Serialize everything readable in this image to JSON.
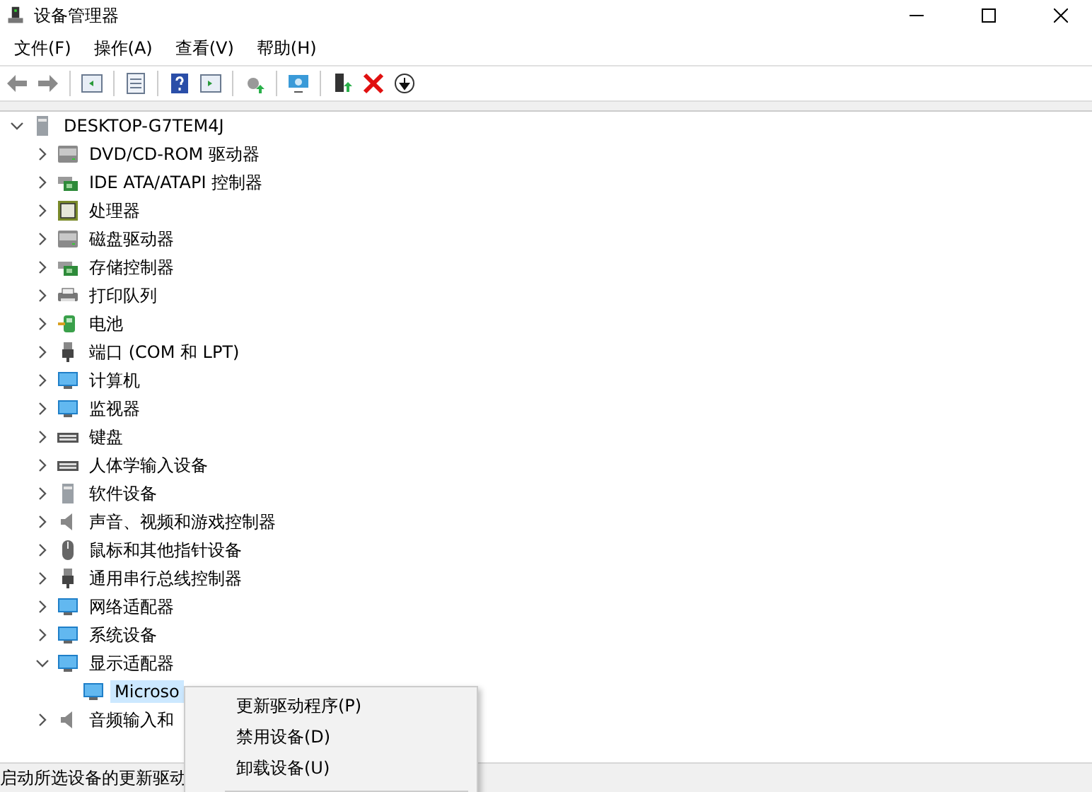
{
  "window": {
    "title": "设备管理器"
  },
  "menu_bar": [
    "文件(F)",
    "操作(A)",
    "查看(V)",
    "帮助(H)"
  ],
  "tree": {
    "label": "DESKTOP-G7TEM4J",
    "expanded": true,
    "selected": false,
    "children": [
      {
        "label": "DVD/CD-ROM 驱动器",
        "expanded": false,
        "selected": false
      },
      {
        "label": "IDE ATA/ATAPI 控制器",
        "expanded": false,
        "selected": false
      },
      {
        "label": "处理器",
        "expanded": false,
        "selected": false
      },
      {
        "label": "磁盘驱动器",
        "expanded": false,
        "selected": false
      },
      {
        "label": "存储控制器",
        "expanded": false,
        "selected": false
      },
      {
        "label": "打印队列",
        "expanded": false,
        "selected": false
      },
      {
        "label": "电池",
        "expanded": false,
        "selected": false
      },
      {
        "label": "端口 (COM 和 LPT)",
        "expanded": false,
        "selected": false
      },
      {
        "label": "计算机",
        "expanded": false,
        "selected": false
      },
      {
        "label": "监视器",
        "expanded": false,
        "selected": false
      },
      {
        "label": "键盘",
        "expanded": false,
        "selected": false
      },
      {
        "label": "人体学输入设备",
        "expanded": false,
        "selected": false
      },
      {
        "label": "软件设备",
        "expanded": false,
        "selected": false
      },
      {
        "label": "声音、视频和游戏控制器",
        "expanded": false,
        "selected": false
      },
      {
        "label": "鼠标和其他指针设备",
        "expanded": false,
        "selected": false
      },
      {
        "label": "通用串行总线控制器",
        "expanded": false,
        "selected": false
      },
      {
        "label": "网络适配器",
        "expanded": false,
        "selected": false
      },
      {
        "label": "系统设备",
        "expanded": false,
        "selected": false
      },
      {
        "label": "显示适配器",
        "expanded": true,
        "selected": false,
        "children": [
          {
            "label": "Microso",
            "selected": true
          }
        ]
      },
      {
        "label": "音频输入和",
        "expanded": false,
        "selected": false
      }
    ]
  },
  "context_menu": {
    "items": [
      {
        "label": "更新驱动程序(P)"
      },
      {
        "label": "禁用设备(D)"
      },
      {
        "label": "卸载设备(U)"
      }
    ]
  },
  "status_bar": {
    "text": "启动所选设备的更新驱动"
  }
}
